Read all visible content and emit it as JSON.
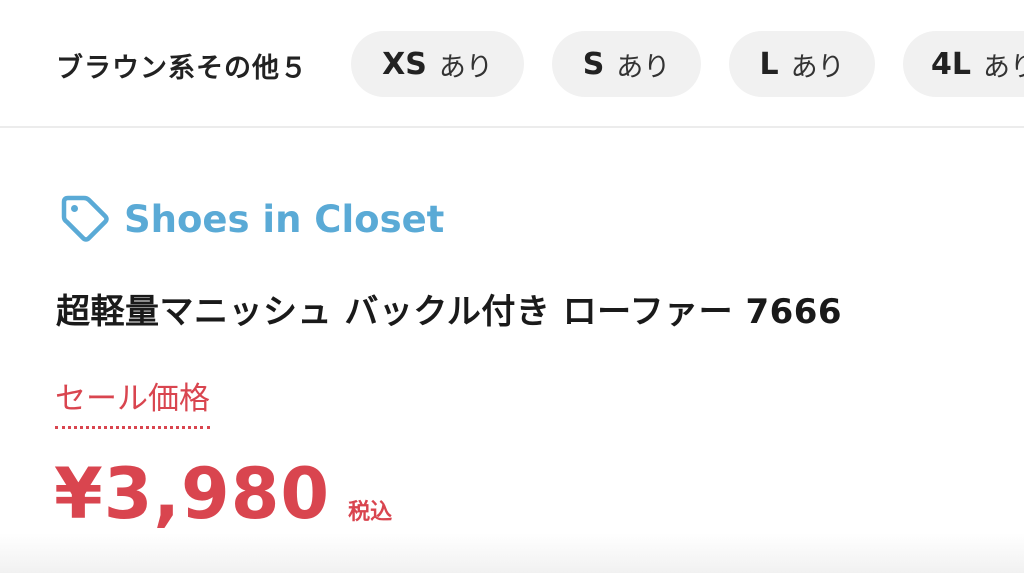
{
  "variants": {
    "color_label": "ブラウン系その他５",
    "sizes": [
      {
        "size": "XS",
        "stock": "あり"
      },
      {
        "size": "S",
        "stock": "あり"
      },
      {
        "size": "L",
        "stock": "あり"
      },
      {
        "size": "4L",
        "stock": "あり"
      }
    ]
  },
  "product": {
    "brand": "Shoes in Closet",
    "brand_icon": "tag-icon",
    "title": "超軽量マニッシュ バックル付き ローファー 7666",
    "sale_label": "セール価格",
    "price": "¥3,980",
    "tax_note": "税込"
  },
  "colors": {
    "brand": "#5aaad6",
    "sale": "#d9454f",
    "chip_bg": "#f1f1f1"
  }
}
